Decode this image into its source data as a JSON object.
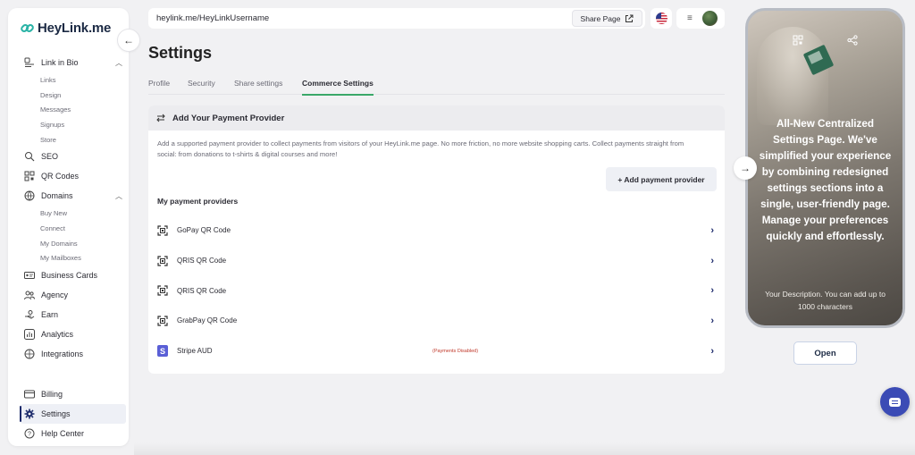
{
  "brand": {
    "name": "HeyLink.me",
    "accent": "#2ab3a6"
  },
  "sidebar": {
    "items": [
      {
        "label": "Link in Bio",
        "icon": "link-in-bio-icon",
        "expanded": true,
        "children": [
          "Links",
          "Design",
          "Messages",
          "Signups",
          "Store"
        ]
      },
      {
        "label": "SEO",
        "icon": "seo-icon"
      },
      {
        "label": "QR Codes",
        "icon": "qr-code-icon"
      },
      {
        "label": "Domains",
        "icon": "globe-icon",
        "expanded": true,
        "children": [
          "Buy New",
          "Connect",
          "My Domains",
          "My Mailboxes"
        ]
      },
      {
        "label": "Business Cards",
        "icon": "business-card-icon"
      },
      {
        "label": "Agency",
        "icon": "agency-icon"
      },
      {
        "label": "Earn",
        "icon": "earn-icon"
      },
      {
        "label": "Analytics",
        "icon": "analytics-icon"
      },
      {
        "label": "Integrations",
        "icon": "integrations-icon"
      }
    ],
    "bottom": [
      {
        "label": "Billing",
        "icon": "billing-icon"
      },
      {
        "label": "Settings",
        "icon": "gear-icon",
        "active": true
      },
      {
        "label": "Help Center",
        "icon": "help-icon"
      }
    ]
  },
  "topbar": {
    "url": "heylink.me/HeyLinkUsername",
    "share_label": "Share Page"
  },
  "page": {
    "title": "Settings",
    "tabs": [
      {
        "label": "Profile"
      },
      {
        "label": "Security"
      },
      {
        "label": "Share settings"
      },
      {
        "label": "Commerce Settings",
        "active": true
      }
    ]
  },
  "payment": {
    "header": "Add Your Payment Provider",
    "description": "Add a supported payment provider to collect payments from visitors of your HeyLink.me page. No more friction, no more website shopping carts. Collect payments straight from social: from donations to t-shirts & digital courses and more!",
    "add_button": "+ Add payment provider",
    "providers_title": "My payment providers",
    "providers": [
      {
        "name": "GoPay QR Code",
        "icon": "qr-scan-icon",
        "status": ""
      },
      {
        "name": "QRIS QR Code",
        "icon": "qr-scan-icon",
        "status": ""
      },
      {
        "name": "QRIS QR Code",
        "icon": "qr-scan-icon",
        "status": ""
      },
      {
        "name": "GrabPay QR Code",
        "icon": "qr-scan-icon",
        "status": ""
      },
      {
        "name": "Stripe AUD",
        "icon": "stripe-icon",
        "status": "(Payments Disabled)"
      }
    ]
  },
  "preview": {
    "headline": "All-New Centralized Settings Page. We've simplified your experience by combining redesigned settings sections into a single, user-friendly page. Manage your preferences quickly and effortlessly.",
    "description": "Your Description. You can add up to 1000 characters",
    "open_label": "Open"
  }
}
